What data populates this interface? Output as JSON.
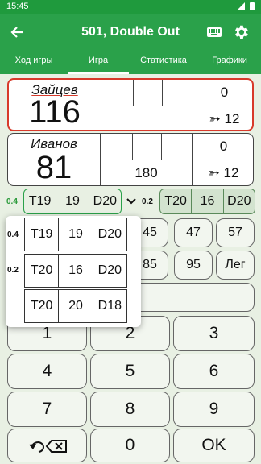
{
  "status_bar": {
    "time": "15:45"
  },
  "app_bar": {
    "title": "501, Double Out"
  },
  "tabs": [
    {
      "label": "Ход игры"
    },
    {
      "label": "Игра"
    },
    {
      "label": "Статистика"
    },
    {
      "label": "Графики"
    }
  ],
  "players": [
    {
      "name": "Зайцев",
      "score": "116",
      "last_score": "0",
      "darts_info": "➳ 12",
      "round_score": ""
    },
    {
      "name": "Иванов",
      "score": "81",
      "last_score": "0",
      "darts_info": "➳ 12",
      "round_score": "180"
    }
  ],
  "suggestions": [
    {
      "prob": "0.4",
      "darts": [
        "T19",
        "19",
        "D20"
      ]
    },
    {
      "prob": "0.2",
      "darts": [
        "T20",
        "16",
        "D20"
      ]
    }
  ],
  "popup": [
    {
      "prob": "0.4",
      "darts": [
        "T19",
        "19",
        "D20"
      ]
    },
    {
      "prob": "0.2",
      "darts": [
        "T20",
        "16",
        "D20"
      ]
    },
    {
      "prob": "",
      "darts": [
        "T20",
        "20",
        "D18"
      ]
    }
  ],
  "quick_keys": [
    "45",
    "47",
    "57",
    "85",
    "95",
    "Лег"
  ],
  "keypad": [
    "1",
    "2",
    "3",
    "4",
    "5",
    "6",
    "7",
    "8",
    "9",
    "0",
    "OK"
  ],
  "colors": {
    "primary": "#2aa14a",
    "status_bar": "#1f9a3d",
    "active_border": "#d83a2b",
    "background": "#e8f0e3"
  }
}
